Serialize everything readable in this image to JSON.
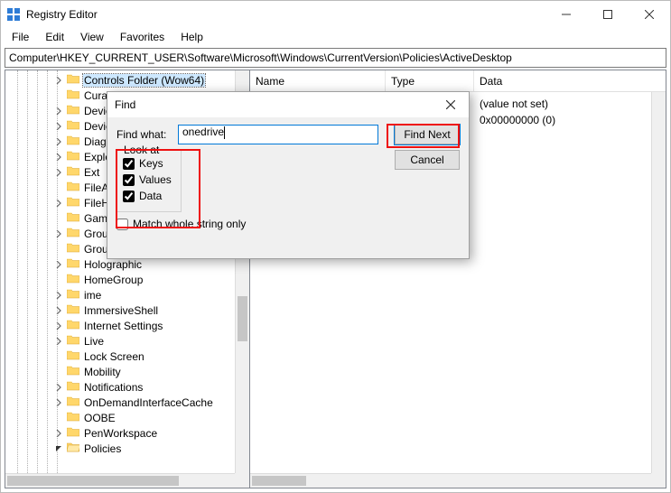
{
  "window": {
    "title": "Registry Editor"
  },
  "menu": [
    "File",
    "Edit",
    "View",
    "Favorites",
    "Help"
  ],
  "address": "Computer\\HKEY_CURRENT_USER\\Software\\Microsoft\\Windows\\CurrentVersion\\Policies\\ActiveDesktop",
  "tree": {
    "items": [
      {
        "label": "Controls Folder (Wow64)",
        "exp": "right",
        "sel": true
      },
      {
        "label": "Curat",
        "exp": ""
      },
      {
        "label": "Device",
        "exp": "right"
      },
      {
        "label": "Device",
        "exp": "right"
      },
      {
        "label": "Diagn",
        "exp": "right"
      },
      {
        "label": "Explo",
        "exp": "right"
      },
      {
        "label": "Ext",
        "exp": "right"
      },
      {
        "label": "FileAs",
        "exp": ""
      },
      {
        "label": "FileHi",
        "exp": "right"
      },
      {
        "label": "Game",
        "exp": ""
      },
      {
        "label": "Group",
        "exp": "right"
      },
      {
        "label": "Group Policy Editor",
        "exp": ""
      },
      {
        "label": "Holographic",
        "exp": "right"
      },
      {
        "label": "HomeGroup",
        "exp": ""
      },
      {
        "label": "ime",
        "exp": "right"
      },
      {
        "label": "ImmersiveShell",
        "exp": "right"
      },
      {
        "label": "Internet Settings",
        "exp": "right"
      },
      {
        "label": "Live",
        "exp": "right"
      },
      {
        "label": "Lock Screen",
        "exp": ""
      },
      {
        "label": "Mobility",
        "exp": ""
      },
      {
        "label": "Notifications",
        "exp": "right"
      },
      {
        "label": "OnDemandInterfaceCache",
        "exp": "right"
      },
      {
        "label": "OOBE",
        "exp": ""
      },
      {
        "label": "PenWorkspace",
        "exp": "right"
      },
      {
        "label": "Policies",
        "exp": "down"
      }
    ]
  },
  "list": {
    "cols": {
      "name": "Name",
      "type": "Type",
      "data": "Data"
    },
    "rows": [
      {
        "name": "",
        "type": "",
        "data": "(value not set)"
      },
      {
        "name": "",
        "type": "",
        "data": "0x00000000 (0)"
      }
    ]
  },
  "find": {
    "title": "Find",
    "what_label": "Find what:",
    "what_value": "onedrive",
    "lookat_label": "Look at",
    "keys_label": "Keys",
    "values_label": "Values",
    "data_label": "Data",
    "match_label": "Match whole string only",
    "find_next": "Find Next",
    "cancel": "Cancel",
    "keys_checked": true,
    "values_checked": true,
    "data_checked": true,
    "match_checked": false
  }
}
